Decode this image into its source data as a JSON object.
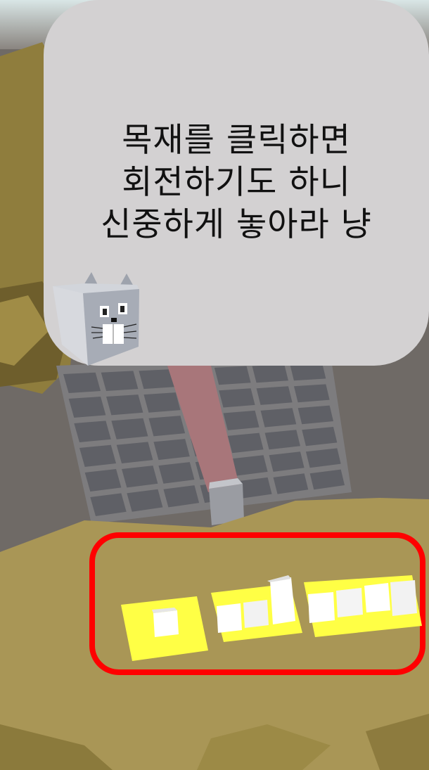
{
  "tutorial": {
    "message_lines": [
      "목재를 클릭하면",
      "회전하기도 하니",
      "신중하게 놓아라 냥"
    ]
  },
  "guide_character": {
    "name": "cat-guide",
    "icon": "cat-face-icon"
  },
  "piece_tray": {
    "highlight_color": "#ff0000",
    "pieces": [
      {
        "name": "wood-piece-1",
        "blocks": 1
      },
      {
        "name": "wood-piece-2",
        "blocks": 3
      },
      {
        "name": "wood-piece-3",
        "blocks": 4
      }
    ]
  },
  "colors": {
    "sand": "#a99656",
    "grid_tile": "#5f6066",
    "rail": "#a8767a",
    "piece_base": "#ffff45",
    "speech_bubble": "#d3d1d2"
  }
}
